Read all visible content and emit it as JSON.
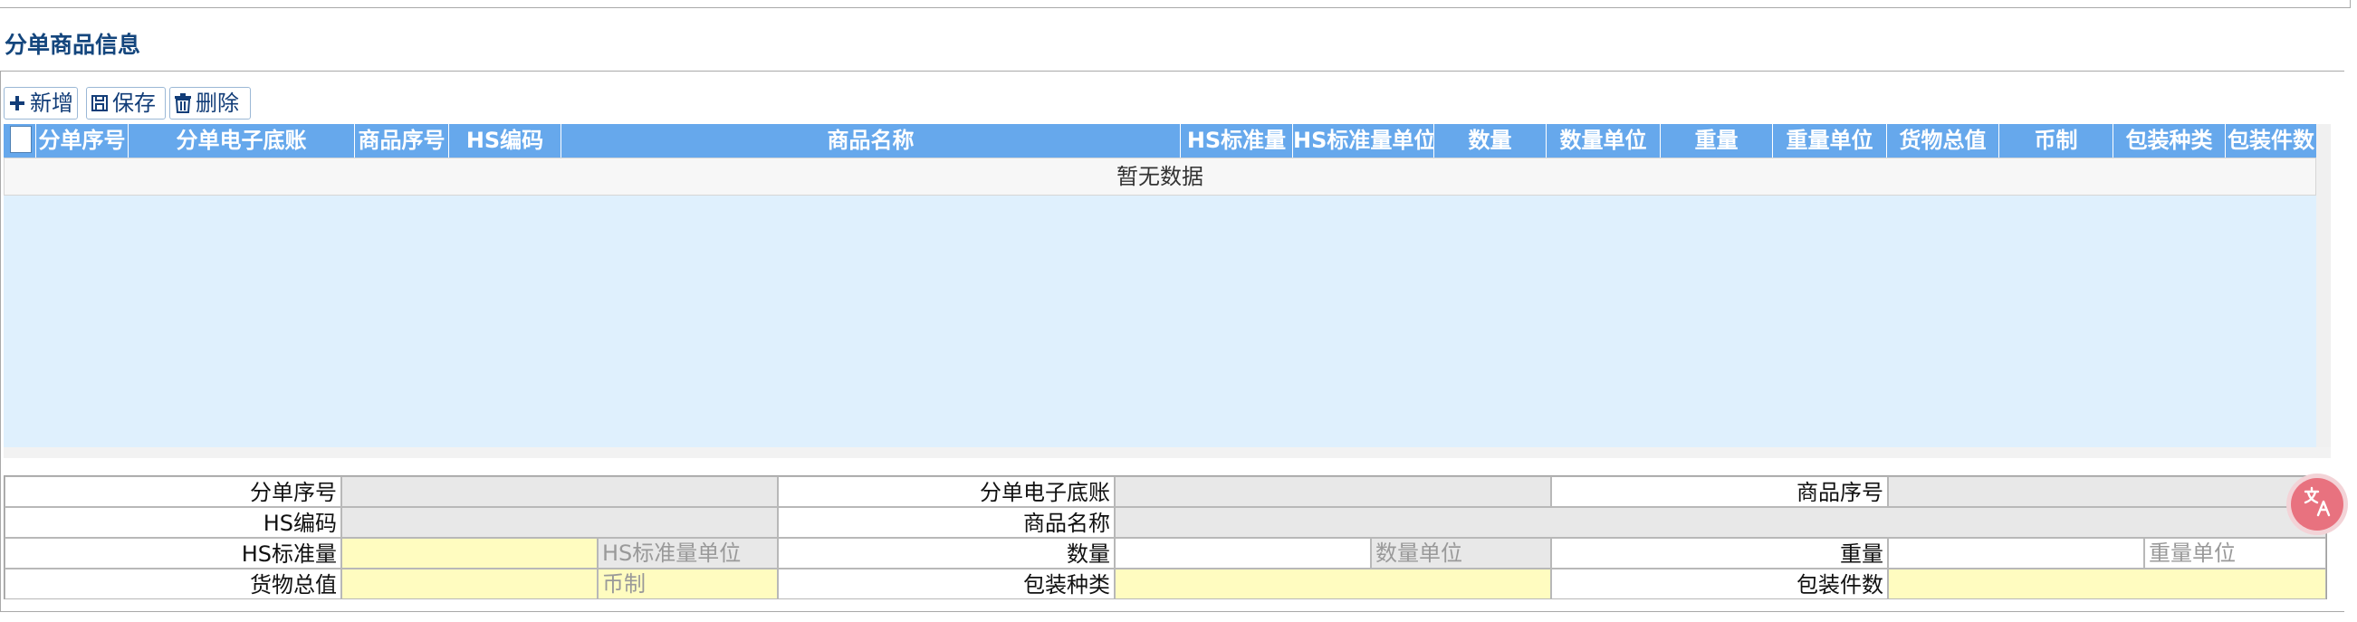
{
  "section_title": "分单商品信息",
  "toolbar": {
    "add_label": "新增",
    "save_label": "保存",
    "delete_label": "删除"
  },
  "grid": {
    "columns": [
      "分单序号",
      "分单电子底账",
      "商品序号",
      "HS编码",
      "商品名称",
      "HS标准量",
      "HS标准量单位",
      "数量",
      "数量单位",
      "重量",
      "重量单位",
      "货物总值",
      "币制",
      "包装种类",
      "包装件数"
    ],
    "empty_text": "暂无数据"
  },
  "form": {
    "row1": {
      "sub_no": "分单序号",
      "sub_ledger": "分单电子底账",
      "goods_no": "商品序号"
    },
    "row2": {
      "hs_code": "HS编码",
      "goods_name": "商品名称"
    },
    "row3": {
      "hs_qty": "HS标准量",
      "hs_unit_placeholder": "HS标准量单位",
      "qty": "数量",
      "qty_unit_placeholder": "数量单位",
      "weight": "重量",
      "weight_unit_placeholder": "重量单位"
    },
    "row4": {
      "total_value": "货物总值",
      "currency_placeholder": "币制",
      "pack_type": "包装种类",
      "pack_count": "包装件数"
    }
  },
  "colors": {
    "title": "#14467d",
    "header_bg": "#66a8ec",
    "body_bg": "#dff0fd",
    "required_bg": "#fffcc0",
    "readonly_bg": "#e8e8e8"
  },
  "icons": [
    "plus-icon",
    "save-icon",
    "trash-icon",
    "translate-icon"
  ]
}
